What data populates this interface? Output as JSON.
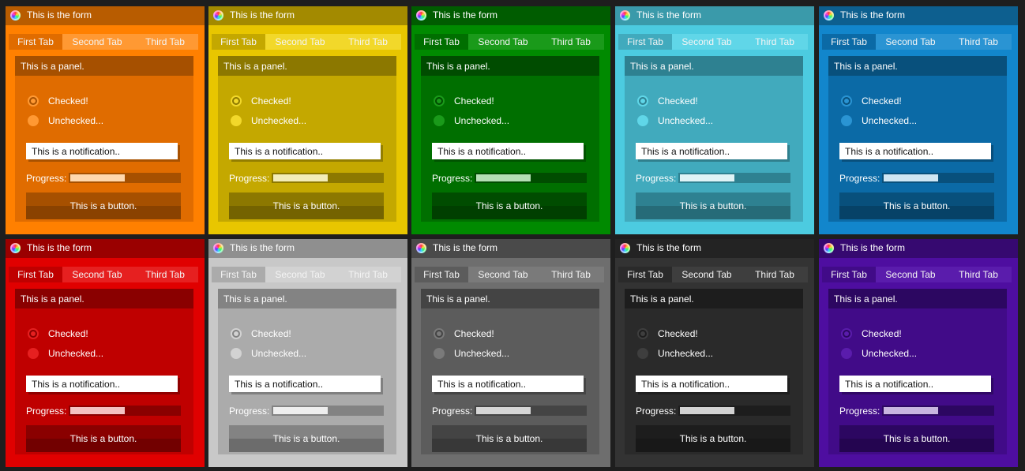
{
  "window_title": "This is the form",
  "tabs": [
    "First Tab",
    "Second Tab",
    "Third Tab"
  ],
  "panel_title": "This is a panel.",
  "radio_checked_label": "Checked!",
  "radio_unchecked_label": "Unchecked...",
  "notification_text": "This is a notification..",
  "progress_label": "Progress:",
  "progress_value": 0.49,
  "button_label": "This is a button.",
  "themes": [
    {
      "id": "orange",
      "base": "#ff8000",
      "title": "#b85c00",
      "light": "#ff9933",
      "dark": "#e06c00",
      "darker": "#a65000",
      "fill": "#ffd8ad"
    },
    {
      "id": "yellow",
      "base": "#e8c600",
      "title": "#a38a00",
      "light": "#f2d82a",
      "dark": "#c4a800",
      "darker": "#8c7800",
      "fill": "#f3ecb8"
    },
    {
      "id": "green",
      "base": "#008a00",
      "title": "#005c00",
      "light": "#1a9a1a",
      "dark": "#006f00",
      "darker": "#004c00",
      "fill": "#b5deb5"
    },
    {
      "id": "cyan",
      "base": "#4ccbe0",
      "title": "#3a9aaa",
      "light": "#60d6e8",
      "dark": "#41aabd",
      "darker": "#2e8191",
      "fill": "#dff3f6"
    },
    {
      "id": "blue",
      "base": "#1286cc",
      "title": "#0d5f8f",
      "light": "#2a94d3",
      "dark": "#0b6aa6",
      "darker": "#08507c",
      "fill": "#cfe6f3"
    },
    {
      "id": "red",
      "base": "#e00000",
      "title": "#9a0000",
      "light": "#e62020",
      "dark": "#bf0000",
      "darker": "#8a0000",
      "fill": "#f4c2c2"
    },
    {
      "id": "lightgray",
      "base": "#c8c8c8",
      "title": "#8f8f8f",
      "light": "#d2d2d2",
      "dark": "#ababab",
      "darker": "#838383",
      "fill": "#eeeeee"
    },
    {
      "id": "gray",
      "base": "#6e6e6e",
      "title": "#4a4a4a",
      "light": "#7a7a7a",
      "dark": "#5c5c5c",
      "darker": "#444444",
      "fill": "#d6d6d6"
    },
    {
      "id": "charcoal",
      "base": "#333333",
      "title": "#232323",
      "light": "#3e3e3e",
      "dark": "#2a2a2a",
      "darker": "#1d1d1d",
      "fill": "#d2d2d2"
    },
    {
      "id": "purple",
      "base": "#4e0ea0",
      "title": "#360970",
      "light": "#5a1cac",
      "dark": "#410b88",
      "darker": "#2c0761",
      "fill": "#c8b5e0"
    }
  ]
}
